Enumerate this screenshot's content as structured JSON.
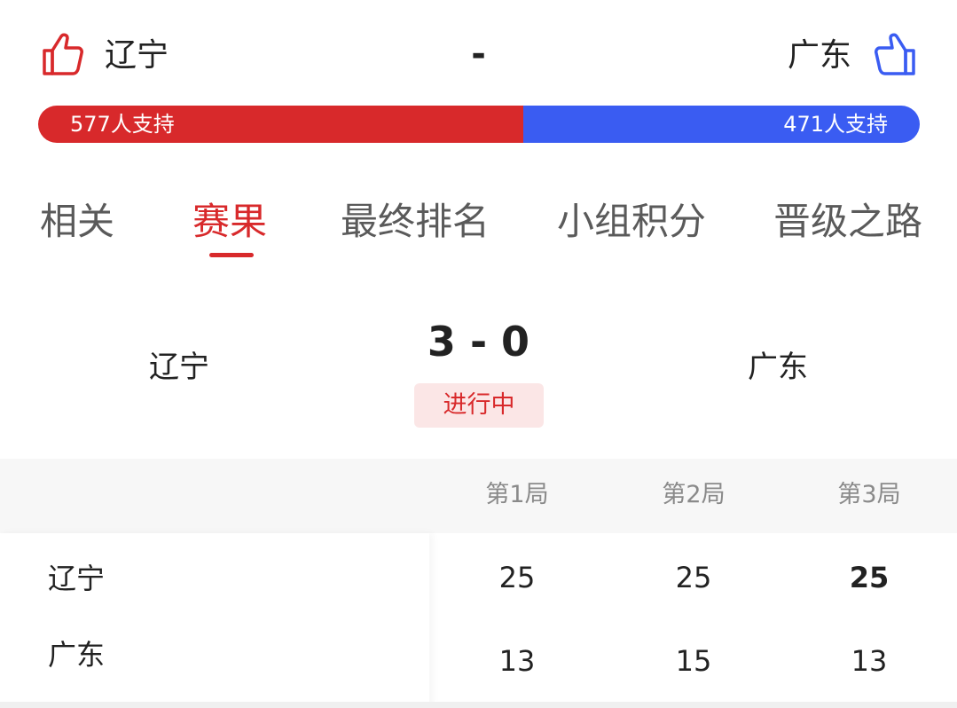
{
  "vote": {
    "home_team": "辽宁",
    "away_team": "广东",
    "separator": "-",
    "home_support": "577人支持",
    "away_support": "471人支持",
    "home_votes": 577,
    "away_votes": 471,
    "home_color": "#d8292b",
    "away_color": "#3a5cf2",
    "home_icon": "thumbs-up-icon",
    "away_icon": "thumbs-up-icon"
  },
  "tabs": [
    {
      "label": "相关",
      "active": false
    },
    {
      "label": "赛果",
      "active": true
    },
    {
      "label": "最终排名",
      "active": false
    },
    {
      "label": "小组积分",
      "active": false
    },
    {
      "label": "晋级之路",
      "active": false
    }
  ],
  "match": {
    "home_team": "辽宁",
    "away_team": "广东",
    "score": "3 - 0",
    "status": "进行中"
  },
  "sets_table": {
    "columns": [
      "第1局",
      "第2局",
      "第3局"
    ],
    "rows": [
      {
        "team": "辽宁",
        "scores": [
          "25",
          "25",
          "25"
        ]
      },
      {
        "team": "广东",
        "scores": [
          "13",
          "15",
          "13"
        ]
      }
    ]
  }
}
